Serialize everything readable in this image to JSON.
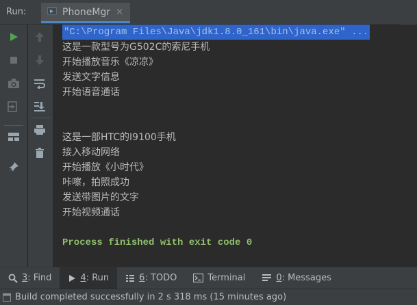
{
  "header": {
    "run_label": "Run:",
    "tab_title": "PhoneMgr",
    "tab_close": "×"
  },
  "console": {
    "command": "\"C:\\Program Files\\Java\\jdk1.8.0_161\\bin\\java.exe\" ...",
    "lines": [
      "这是一款型号为G502C的索尼手机",
      "开始播放音乐《凉凉》",
      "发送文字信息",
      "开始语音通话",
      "",
      "",
      "这是一部HTC的I9100手机",
      "接入移动网络",
      "开始播放《小时代》",
      "咔嚓，拍照成功",
      "发送带图片的文字",
      "开始视频通话",
      "",
      "Process finished with exit code 0"
    ]
  },
  "bottom_bar": {
    "find": {
      "num": "3",
      "label": ": Find"
    },
    "run": {
      "num": "4",
      "label": ": Run"
    },
    "todo": {
      "num": "6",
      "label": ": TODO"
    },
    "terminal": {
      "label": "Terminal"
    },
    "messages": {
      "num": "0",
      "label": ": Messages"
    }
  },
  "status": {
    "text": "Build completed successfully in 2 s 318 ms (15 minutes ago)"
  },
  "colors": {
    "run_green": "#4fa54f",
    "selection_blue": "#2f65ca",
    "exit_green": "#8fbf6a"
  }
}
